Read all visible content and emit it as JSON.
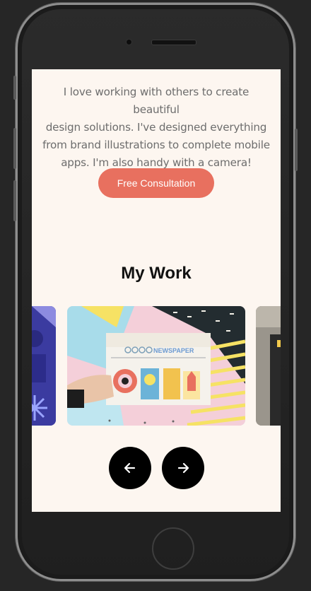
{
  "intro": {
    "line1": "I love working with others to create beautiful",
    "line2": "design solutions. I've designed everything",
    "line3": "from brand illustrations to complete mobile",
    "line4": "apps. I'm also handy with a camera!"
  },
  "cta_label": "Free Consultation",
  "work": {
    "title": "My Work",
    "newspaper_masthead": "NEWSPAPER"
  },
  "icons": {
    "prev": "arrow-left-icon",
    "next": "arrow-right-icon"
  },
  "colors": {
    "accent": "#e8705f",
    "page_bg": "#fdf6f0",
    "device_bg": "#262626"
  }
}
